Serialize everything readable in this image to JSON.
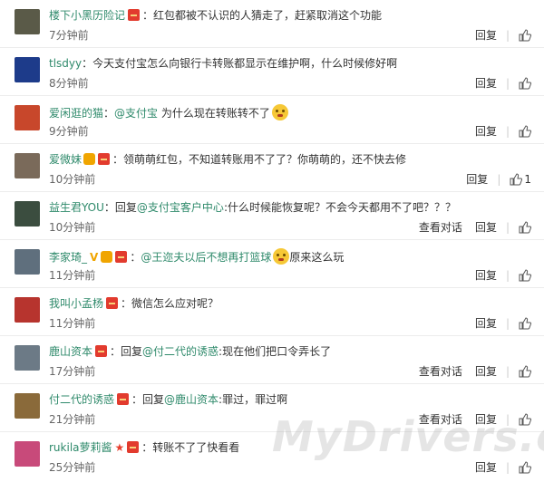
{
  "actions": {
    "reply": "回复",
    "view_conversation": "查看对话"
  },
  "comments": [
    {
      "username": "楼下小黑历险记",
      "text": "：红包都被不认识的人猜走了，赶紧取消这个功能",
      "time": "7分钟前",
      "avatar_color": "#5a5a48",
      "has_badge": true
    },
    {
      "username": "tlsdyy",
      "text": "：今天支付宝怎么向银行卡转账都显示在维护啊，什么时候修好啊",
      "time": "8分钟前",
      "avatar_color": "#1d3b8a",
      "has_badge": false
    },
    {
      "username": "爱闲逛的猫",
      "text_prefix": "：",
      "mention": "@支付宝",
      "text": " 为什么现在转账转不了",
      "time": "9分钟前",
      "avatar_color": "#c8472b",
      "has_badge": false,
      "emoji": "surprised-emoji"
    },
    {
      "username": "爱微妹",
      "text": "：领萌萌红包，不知道转账用不了了？你萌萌的，还不快去修",
      "time": "10分钟前",
      "avatar_color": "#7a6a5a",
      "has_badge": true,
      "likes": "1"
    },
    {
      "username": "益生君YOU",
      "text_prefix": "：回复",
      "mention": "@支付宝客户中心",
      "text": ":什么时候能恢复呢？不会今天都用不了吧？？？",
      "time": "10分钟前",
      "avatar_color": "#3b4d3f",
      "has_badge": false
    },
    {
      "username": "李家琦_",
      "text_prefix": "：",
      "mention": "@王迩夫以后不想再打篮球",
      "text": "原来这么玩",
      "time": "11分钟前",
      "avatar_color": "#5f6f7d",
      "has_badge": true,
      "emoji": "smirk-emoji"
    },
    {
      "username": "我叫小孟杨",
      "text": "：微信怎么应对呢？",
      "time": "11分钟前",
      "avatar_color": "#b7342e",
      "has_badge": true
    },
    {
      "username": "鹿山资本",
      "text_prefix": "：回复",
      "mention": "@付二代的诱惑",
      "text": ":现在他们把口令弄长了",
      "time": "17分钟前",
      "avatar_color": "#6c7a86",
      "has_badge": true
    },
    {
      "username": "付二代的诱惑",
      "text_prefix": "：回复",
      "mention": "@鹿山资本",
      "text": ":罪过，罪过啊",
      "time": "21分钟前",
      "avatar_color": "#8a6a3a",
      "has_badge": true
    },
    {
      "username": "rukila萝莉酱",
      "text": "：转账不了了快看看",
      "time": "25分钟前",
      "avatar_color": "#c84a7a",
      "has_badge": true
    }
  ],
  "watermark": "MyDrivers.com"
}
